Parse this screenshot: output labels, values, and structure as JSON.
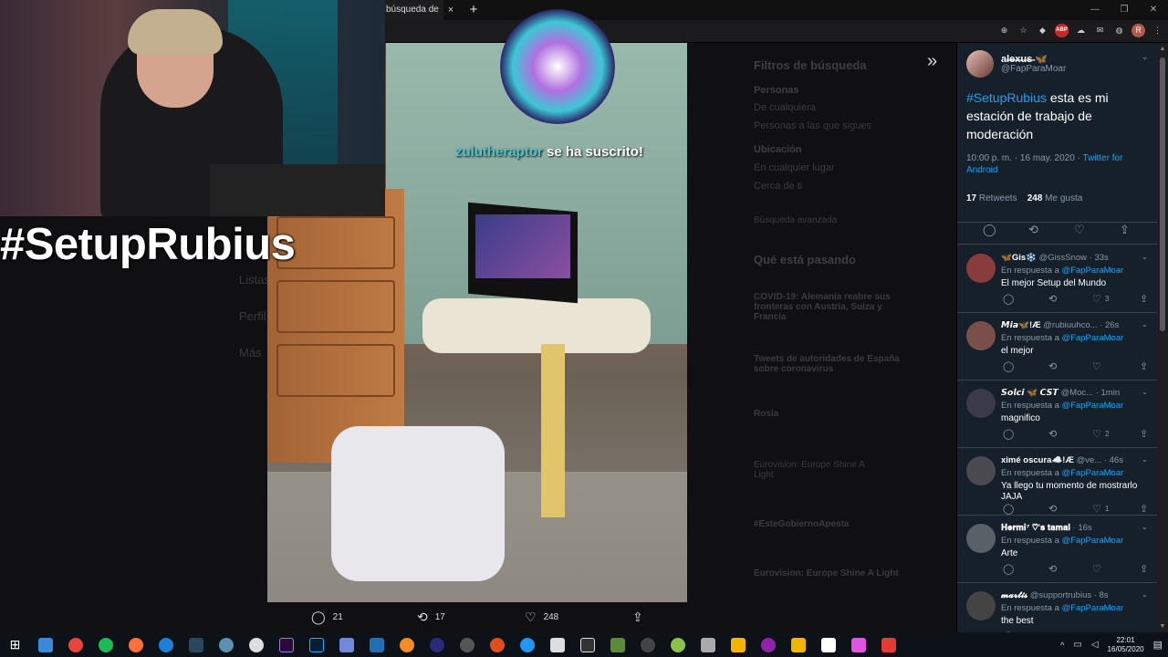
{
  "browser": {
    "tab_title": "búsqueda de",
    "tab_close": "×",
    "new_tab": "+",
    "window_buttons": [
      "—",
      "❐",
      "✕"
    ]
  },
  "stream": {
    "hashtag": "#SetupRubius",
    "sub_user": "zulutheraptor",
    "sub_text": "se ha suscrito!"
  },
  "background": {
    "filters_title": "Filtros de búsqueda",
    "people_label": "Personas",
    "people_opt1": "De cualquiera",
    "people_opt2": "Personas a las que sigues",
    "location_label": "Ubicación",
    "location_opt1": "En cualquier lugar",
    "location_opt2": "Cerca de ti",
    "advanced": "Búsqueda avanzada",
    "trends_title": "Qué está pasando",
    "trend1": "COVID-19: Alemania reabre sus fronteras con Austria, Suiza y Francia",
    "trend2": "Tweets de autoridades de España sobre coronavirus",
    "trend3": "Rosia",
    "trend4": "Eurovision: Europe Shine A Light",
    "trend5": "#EsteGobiernoApesta",
    "trend6": "Eurovision: Europe Shine A Light",
    "left_nav1": "Listas",
    "left_nav2": "Perfil",
    "left_nav3": "Más"
  },
  "photo_bar": {
    "replies": "21",
    "retweets": "17",
    "likes": "248"
  },
  "main_tweet": {
    "name": "al̶e̶x̶u̶s̶ 🦋",
    "handle": "@FapParaMoar",
    "hashtag": "#SetupRubius",
    "text": " esta es mi estación de trabajo de moderación",
    "date": "10:00 p. m. · 16 may. 2020 · ",
    "source": "Twitter for Android",
    "retweets": "17",
    "retweets_label": " Retweets",
    "likes": "248",
    "likes_label": " Me gusta"
  },
  "replies": [
    {
      "name": "🦋Gis❄️",
      "handle": "@GissSnow · 33s",
      "ctx": "En respuesta a ",
      "to": "@FapParaMoar",
      "text": "El mejor Setup del Mundo",
      "likes": "3",
      "color": "#8a3b3b"
    },
    {
      "name": "𝙈𝙞𝙖🦋!Æ",
      "handle": "@rubiuuhco... · 26s",
      "ctx": "En respuesta a ",
      "to": "@FapParaMoar",
      "text": "el mejor",
      "likes": "",
      "color": "#7a4e4a"
    },
    {
      "name": "𝙎𝙤𝙡𝙘𝙞 🦋 𝘾𝙎𝙏",
      "handle": "@Moc... · 1min",
      "ctx": "En respuesta a ",
      "to": "@FapParaMoar",
      "text": "magnifico",
      "likes": "2",
      "color": "#3a3a48"
    },
    {
      "name": "ximé oscura☁️!Æ",
      "handle": "@ve... · 46s",
      "ctx": "En respuesta a ",
      "to": "@FapParaMoar",
      "text": "Ya llego tu momento de mostrarlo JAJA",
      "likes": "1",
      "color": "#4a4a50"
    },
    {
      "name": "𝐇𝐞𝐫𝐦𝐢⁷ ♡'𝐬 𝐭𝐚𝐦𝐚𝐥",
      "handle": "· 16s",
      "ctx": "En respuesta a ",
      "to": "@FapParaMoar",
      "text": "Arte",
      "likes": "",
      "color": "#5a6068"
    },
    {
      "name": "𝓶𝓪𝓻𝓽𝓲𝓼",
      "handle": "@supportrubius · 8s",
      "ctx": "En respuesta a ",
      "to": "@FapParaMoar",
      "text": "the best",
      "likes": "",
      "color": "#444"
    }
  ],
  "taskbar": {
    "time": "22:01",
    "date": "16/05/2020"
  }
}
